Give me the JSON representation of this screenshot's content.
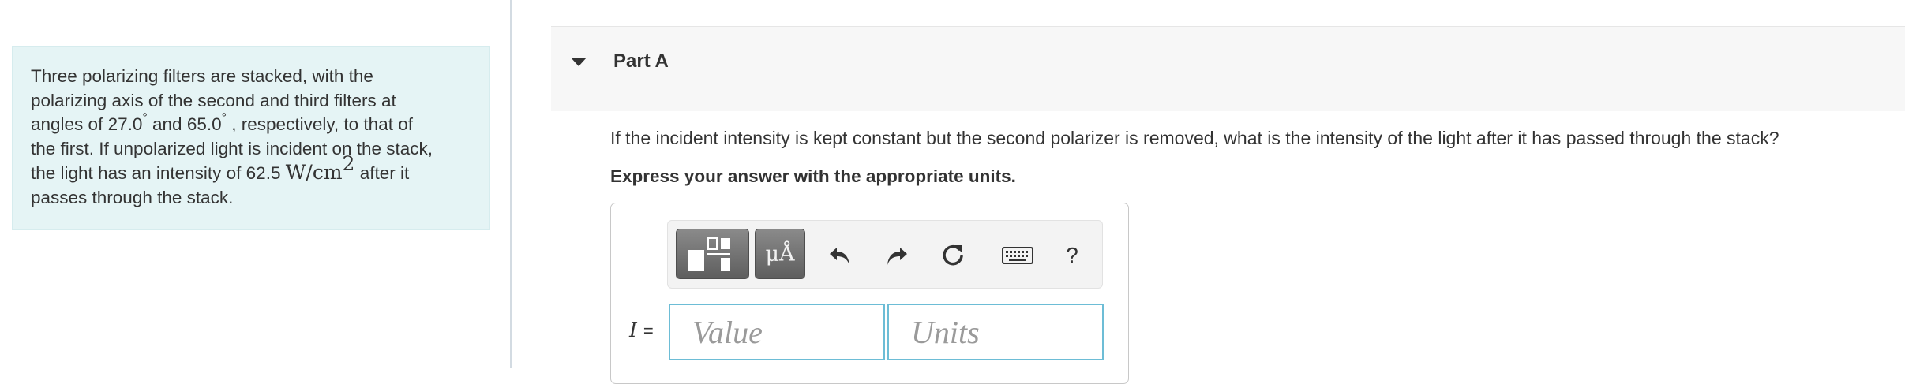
{
  "problem": {
    "line1": "Three polarizing filters are stacked, with the",
    "line2": "polarizing axis of the second and third filters at",
    "line3_a": "angles of 27.0",
    "line3_deg1": "°",
    "line3_b": " and 65.0",
    "line3_deg2": "°",
    "line3_c": " , respectively, to that of",
    "line4": "the first. If unpolarized light is incident on the stack,",
    "line5_a": "the light has an intensity of 62.5 ",
    "line5_unit": "W/cm",
    "line5_exp": "2",
    "line5_b": " after it",
    "line6": "passes through the stack."
  },
  "part": {
    "title": "Part A",
    "question": "If the incident intensity is kept constant but the second polarizer is removed, what is the intensity of the light after it has passed through the stack?",
    "instruction": "Express your answer with the appropriate units."
  },
  "toolbar": {
    "templates_icon": "templates-icon",
    "units_label": "μÅ",
    "undo_icon": "undo-icon",
    "redo_icon": "redo-icon",
    "reset_icon": "reset-icon",
    "keyboard_icon": "keyboard-icon",
    "help_label": "?"
  },
  "answer": {
    "variable": "I",
    "equals": "=",
    "value_placeholder": "Value",
    "units_placeholder": "Units",
    "value": "",
    "units": ""
  },
  "colors": {
    "problem_bg": "#e5f4f5",
    "input_border": "#6dbdd6",
    "toolbar_button": "#6e6e6e"
  }
}
